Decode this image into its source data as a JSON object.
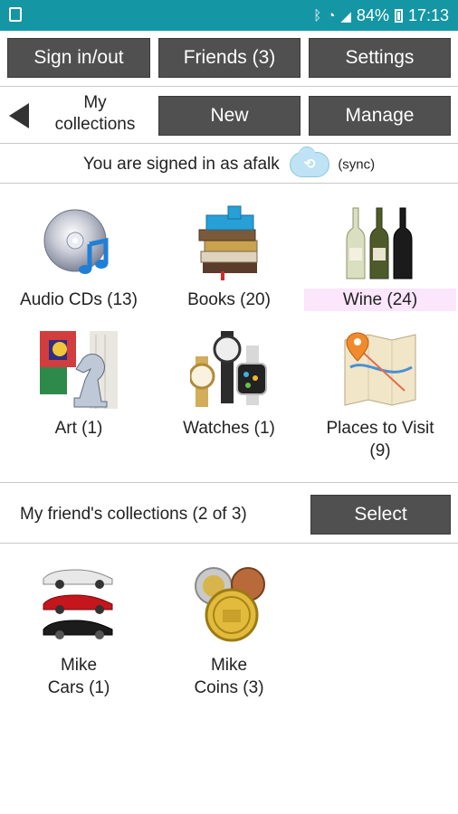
{
  "status_bar": {
    "battery": "84%",
    "time": "17:13",
    "wifi_icon": "wifi-icon",
    "bluetooth_icon": "bluetooth-icon",
    "signal_icon": "signal-icon"
  },
  "top_buttons": {
    "sign_in_out": "Sign in/out",
    "friends": "Friends (3)",
    "settings": "Settings"
  },
  "nav": {
    "back_icon": "back-arrow-icon",
    "title_line1": "My",
    "title_line2": "collections",
    "new_button": "New",
    "manage_button": "Manage"
  },
  "signin": {
    "text": "You are signed in as afalk",
    "cloud_glyph": "⟲",
    "sync": "(sync)"
  },
  "collections": [
    {
      "label": "Audio CDs (13)",
      "icon": "cd-music-icon"
    },
    {
      "label": "Books (20)",
      "icon": "books-icon"
    },
    {
      "label": "Wine (24)",
      "icon": "wine-bottles-icon"
    },
    {
      "label": "Art (1)",
      "icon": "art-chess-icon"
    },
    {
      "label": "Watches (1)",
      "icon": "watches-icon"
    },
    {
      "label_line1": "Places to Visit",
      "label_line2": "(9)",
      "icon": "map-pin-icon"
    }
  ],
  "friends_section": {
    "label": "My friend's collections (2 of 3)",
    "select_button": "Select"
  },
  "friend_collections": [
    {
      "line1": "Mike",
      "line2": "Cars (1)",
      "icon": "cars-icon"
    },
    {
      "line1": "Mike",
      "line2": "Coins (3)",
      "icon": "coins-icon"
    }
  ],
  "colors": {
    "status_bar": "#1596a4",
    "button_bg": "#505050",
    "highlight": "#fbe6fb"
  }
}
